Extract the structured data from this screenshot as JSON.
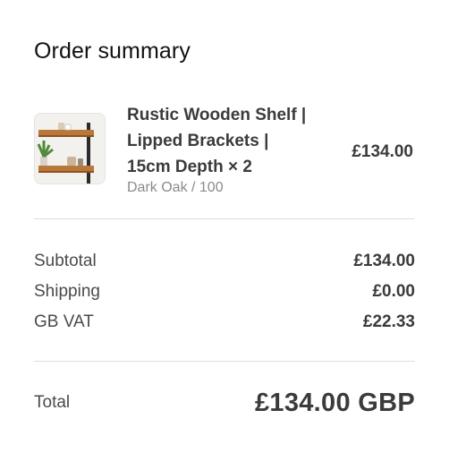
{
  "order_summary": {
    "heading": "Order summary",
    "line_items": [
      {
        "title_lines": [
          "Rustic Wooden Shelf |",
          "Lipped Brackets |",
          "15cm Depth × 2"
        ],
        "variant": "Dark Oak / 100",
        "price": "£134.00",
        "thumbnail": "wooden-shelf-product-image"
      }
    ],
    "subtotal": {
      "label": "Subtotal",
      "value": "£134.00"
    },
    "shipping": {
      "label": "Shipping",
      "value": "£0.00"
    },
    "tax": {
      "label": "GB VAT",
      "value": "£22.33"
    },
    "total": {
      "label": "Total",
      "value": "£134.00 GBP"
    }
  }
}
